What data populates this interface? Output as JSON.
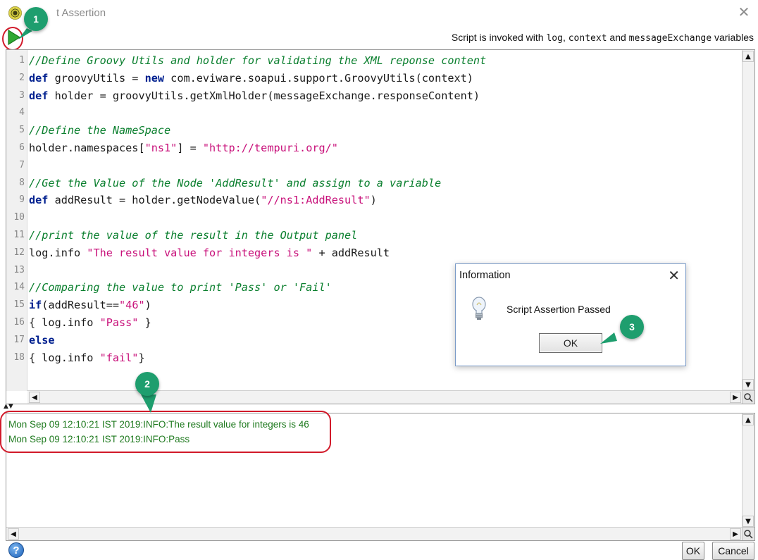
{
  "window": {
    "title": "Script Assertion",
    "visible_title": "t Assertion",
    "close_glyph": "✕"
  },
  "toolbar": {
    "run_icon": "play-icon",
    "info_prefix": "Script is invoked with ",
    "info_var1": "log",
    "info_sep1": ", ",
    "info_var2": "context",
    "info_and": " and ",
    "info_var3": "messageExchange",
    "info_suffix": " variables"
  },
  "editor": {
    "line_numbers": [
      "1",
      "2",
      "3",
      "4",
      "5",
      "6",
      "7",
      "8",
      "9",
      "10",
      "11",
      "12",
      "13",
      "14",
      "15",
      "16",
      "17",
      "18"
    ],
    "lines": [
      [
        {
          "t": "cm",
          "v": "//Define Groovy Utils and holder for validating the XML reponse content"
        }
      ],
      [
        {
          "t": "kw",
          "v": "def"
        },
        {
          "t": "",
          "v": " groovyUtils = "
        },
        {
          "t": "kw",
          "v": "new"
        },
        {
          "t": "",
          "v": " com.eviware.soapui.support.GroovyUtils(context)"
        }
      ],
      [
        {
          "t": "kw",
          "v": "def"
        },
        {
          "t": "",
          "v": " holder = groovyUtils.getXmlHolder(messageExchange.responseContent)"
        }
      ],
      [],
      [
        {
          "t": "cm",
          "v": "//Define the NameSpace"
        }
      ],
      [
        {
          "t": "",
          "v": "holder.namespaces["
        },
        {
          "t": "st",
          "v": "\"ns1\""
        },
        {
          "t": "",
          "v": "] = "
        },
        {
          "t": "st",
          "v": "\"http://tempuri.org/\""
        }
      ],
      [],
      [
        {
          "t": "cm",
          "v": "//Get the Value of the Node 'AddResult' and assign to a variable"
        }
      ],
      [
        {
          "t": "kw",
          "v": "def"
        },
        {
          "t": "",
          "v": " addResult = holder.getNodeValue("
        },
        {
          "t": "st",
          "v": "\"//ns1:AddResult\""
        },
        {
          "t": "",
          "v": ")"
        }
      ],
      [],
      [
        {
          "t": "cm",
          "v": "//print the value of the result in the Output panel"
        }
      ],
      [
        {
          "t": "",
          "v": "log.info "
        },
        {
          "t": "st",
          "v": "\"The result value for integers is \""
        },
        {
          "t": "",
          "v": " + addResult"
        }
      ],
      [],
      [
        {
          "t": "cm",
          "v": "//Comparing the value to print 'Pass' or 'Fail'"
        }
      ],
      [
        {
          "t": "kw",
          "v": "if"
        },
        {
          "t": "",
          "v": "(addResult=="
        },
        {
          "t": "st",
          "v": "\"46\""
        },
        {
          "t": "",
          "v": ")"
        }
      ],
      [
        {
          "t": "",
          "v": "{ log.info "
        },
        {
          "t": "st",
          "v": "\"Pass\""
        },
        {
          "t": "",
          "v": " }"
        }
      ],
      [
        {
          "t": "kw",
          "v": "else"
        }
      ],
      [
        {
          "t": "",
          "v": "{ log.info "
        },
        {
          "t": "st",
          "v": "\"fail\""
        },
        {
          "t": "",
          "v": "}"
        }
      ]
    ],
    "scroll_up": "▲",
    "scroll_down": "▼",
    "scroll_left": "◀",
    "scroll_right": "▶"
  },
  "log": {
    "lines": [
      "Mon Sep 09 12:10:21 IST 2019:INFO:The result value for integers is 46",
      "Mon Sep 09 12:10:21 IST 2019:INFO:Pass"
    ]
  },
  "dialog": {
    "title": "Information",
    "close_glyph": "✕",
    "message": "Script Assertion Passed",
    "ok_label": "OK",
    "icon": "lightbulb-icon"
  },
  "footer": {
    "help_label": "?",
    "ok_label": "OK",
    "cancel_label": "Cancel"
  },
  "callouts": {
    "one": "1",
    "two": "2",
    "three": "3"
  },
  "colors": {
    "comment": "#0a7f2e",
    "keyword": "#00208f",
    "string": "#c8107a",
    "log_text": "#1f7a1f",
    "callout": "#1e9e6e",
    "highlight_ring": "#d11a2a"
  }
}
